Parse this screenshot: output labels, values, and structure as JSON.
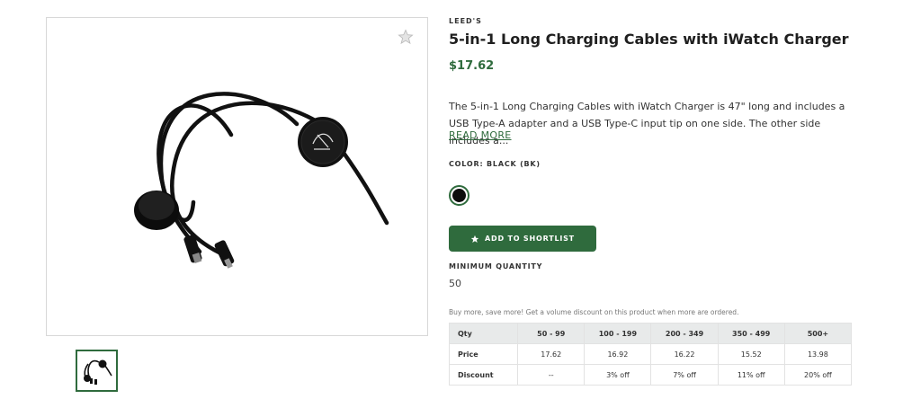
{
  "product": {
    "brand": "LEED'S",
    "title": "5-in-1 Long Charging Cables with iWatch Charger",
    "price": "$17.62",
    "description": "The 5-in-1 Long Charging Cables with iWatch Charger is 47\" long and includes a USB Type-A adapter and a USB Type-C input tip on one side. The other side includes a...",
    "read_more": "READ MORE",
    "color_label": "COLOR: BLACK (BK)",
    "swatch_color": "#0d0d0d",
    "add_button": "ADD TO SHORTLIST",
    "min_qty_label": "MINIMUM QUANTITY",
    "min_qty_value": "50",
    "volume_note": "Buy more, save more! Get a volume discount on this product when more are ordered."
  },
  "gallery": {
    "favorite_icon": "star-icon",
    "thumbnail_count": 1
  },
  "pricing_table": {
    "headers": [
      "Qty",
      "50 - 99",
      "100 - 199",
      "200 - 349",
      "350 - 499",
      "500+"
    ],
    "rows": [
      [
        "Price",
        "17.62",
        "16.92",
        "16.22",
        "15.52",
        "13.98"
      ],
      [
        "Discount",
        "--",
        "3% off",
        "7% off",
        "11% off",
        "20% off"
      ]
    ]
  },
  "colors": {
    "accent": "#2f6b3d",
    "table_header": "#e8eaea"
  }
}
